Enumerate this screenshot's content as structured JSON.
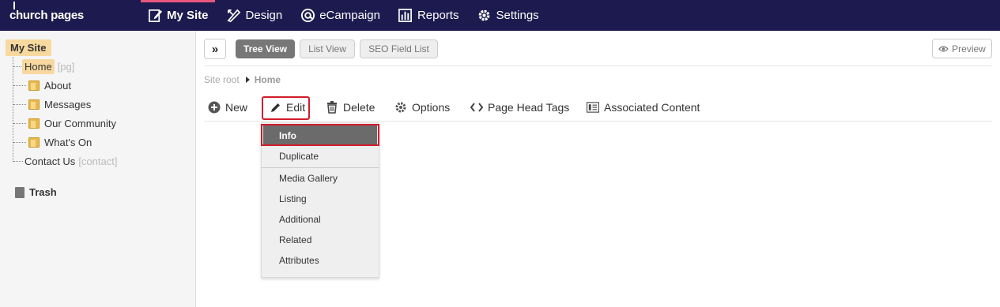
{
  "app": {
    "logo": "church pages"
  },
  "nav": [
    {
      "label": "My Site",
      "icon": "edit-page-icon",
      "active": true
    },
    {
      "label": "Design",
      "icon": "design-tools-icon",
      "active": false
    },
    {
      "label": "eCampaign",
      "icon": "at-sign-icon",
      "active": false
    },
    {
      "label": "Reports",
      "icon": "bar-chart-icon",
      "active": false
    },
    {
      "label": "Settings",
      "icon": "gear-icon",
      "active": false
    }
  ],
  "sidebar": {
    "root": "My Site",
    "home": {
      "label": "Home",
      "tag": "[pg]"
    },
    "folders": [
      "About",
      "Messages",
      "Our Community",
      "What's On"
    ],
    "contact": {
      "label": "Contact Us",
      "tag": "[contact]"
    },
    "trash": "Trash"
  },
  "views": {
    "tree": "Tree View",
    "list": "List View",
    "seo": "SEO Field List",
    "preview": "Preview"
  },
  "breadcrumb": {
    "root": "Site root",
    "current": "Home"
  },
  "toolbar": {
    "new": "New",
    "edit": "Edit",
    "delete": "Delete",
    "options": "Options",
    "head_tags": "Page Head Tags",
    "associated": "Associated Content"
  },
  "edit_menu": [
    "Info",
    "Duplicate",
    "Media Gallery",
    "Listing",
    "Additional",
    "Related",
    "Attributes"
  ],
  "colors": {
    "topbar": "#1c1a4e",
    "active_accent": "#e8577b",
    "highlight": "#f7d9a0",
    "annotation": "#d21b2a"
  }
}
